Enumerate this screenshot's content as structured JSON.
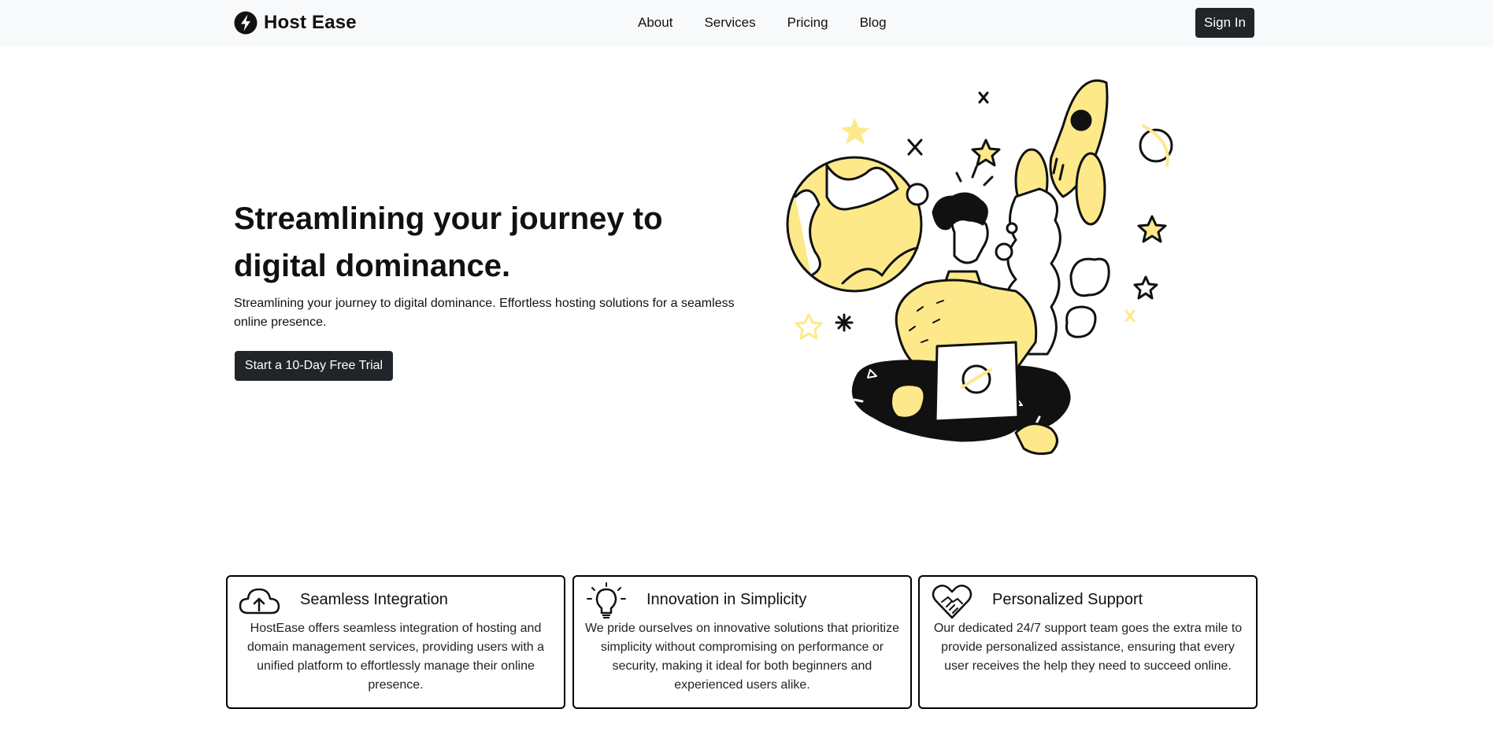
{
  "nav": {
    "brand_name": "Host Ease",
    "brand_icon": "lightning-bolt-icon",
    "links": [
      "About",
      "Services",
      "Pricing",
      "Blog"
    ],
    "signin_label": "Sign In"
  },
  "hero": {
    "title": "Streamlining your journey to digital dominance.",
    "subtitle": "Streamlining your journey to digital dominance. Effortless hosting solutions for a seamless online presence.",
    "cta_label": "Start a 10-Day Free Trial",
    "illustration": "person-with-laptop-and-rocket-illustration"
  },
  "features": [
    {
      "icon": "cloud-upload-icon",
      "title": "Seamless Integration",
      "text": "HostEase offers seamless integration of hosting and domain management services, providing users with a unified platform to effortlessly manage their online presence."
    },
    {
      "icon": "lightbulb-icon",
      "title": "Innovation in Simplicity",
      "text": "We pride ourselves on innovative solutions that prioritize simplicity without compromising on performance or security, making it ideal for both beginners and experienced users alike."
    },
    {
      "icon": "handshake-heart-icon",
      "title": "Personalized Support",
      "text": "Our dedicated 24/7 support team goes the extra mile to provide personalized assistance, ensuring that every user receives the help they need to succeed online."
    }
  ],
  "colors": {
    "navbar_bg": "#f8f9fa",
    "button_bg": "#212529",
    "accent_yellow": "#fde98a"
  }
}
